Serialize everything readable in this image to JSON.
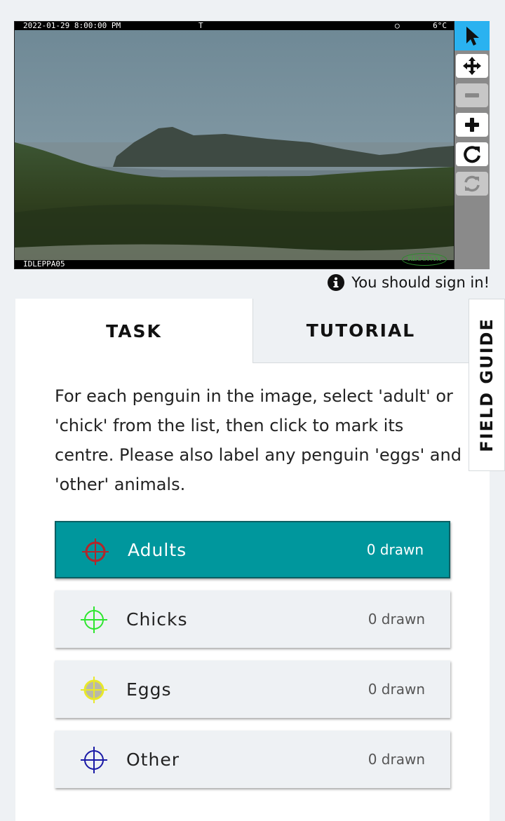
{
  "camera": {
    "timestamp": "2022-01-29  8:00:00 PM",
    "flag": "T",
    "temperature": "6°C",
    "camera_id": "IDLEPPA05",
    "brand": "RECONYX"
  },
  "toolbar": {
    "tools": [
      {
        "name": "pointer",
        "icon": "cursor-arrow-icon",
        "state": "active"
      },
      {
        "name": "pan",
        "icon": "move-arrows-icon",
        "state": "enabled"
      },
      {
        "name": "zoom-out",
        "icon": "minus-icon",
        "state": "disabled"
      },
      {
        "name": "zoom-in",
        "icon": "plus-icon",
        "state": "enabled"
      },
      {
        "name": "rotate",
        "icon": "rotate-icon",
        "state": "enabled"
      },
      {
        "name": "reset",
        "icon": "refresh-icon",
        "state": "disabled"
      }
    ]
  },
  "signin": {
    "text": "You should sign in!",
    "icon": "info-icon"
  },
  "tabs": {
    "task": "TASK",
    "tutorial": "TUTORIAL"
  },
  "field_guide": "FIELD GUIDE",
  "instructions": "For each penguin in the image, select 'adult' or 'chick' from the list, then click to mark its centre. Please also label any penguin 'eggs' and 'other' animals.",
  "marking_tools": [
    {
      "label": "Adults",
      "count": "0 drawn",
      "color": "#b3262a",
      "selected": true
    },
    {
      "label": "Chicks",
      "count": "0 drawn",
      "color": "#2ee62e",
      "selected": false
    },
    {
      "label": "Eggs",
      "count": "0 drawn",
      "color": "#e8e82a",
      "selected": false
    },
    {
      "label": "Other",
      "count": "0 drawn",
      "color": "#1a1aa6",
      "selected": false
    }
  ],
  "colors": {
    "accent": "#00979d",
    "active_tool": "#2ab2f0"
  }
}
